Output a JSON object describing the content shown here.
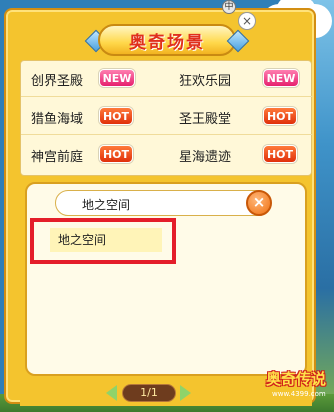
{
  "title": "奥奇场景",
  "header": {
    "pin_label": "中",
    "close_label": "×"
  },
  "scenes": [
    {
      "name": "创界圣殿",
      "badge": "NEW",
      "badge_type": "new"
    },
    {
      "name": "狂欢乐园",
      "badge": "NEW",
      "badge_type": "new"
    },
    {
      "name": "猎鱼海域",
      "badge": "HOT",
      "badge_type": "hot"
    },
    {
      "name": "圣王殿堂",
      "badge": "HOT",
      "badge_type": "hot"
    },
    {
      "name": "神宫前庭",
      "badge": "HOT",
      "badge_type": "hot"
    },
    {
      "name": "星海遗迹",
      "badge": "HOT",
      "badge_type": "hot"
    }
  ],
  "search": {
    "value": "地之空间",
    "clear_label": "×"
  },
  "results": [
    "地之空间"
  ],
  "pager": {
    "label": "1/1"
  },
  "logo": {
    "text": "奥奇传说",
    "sub": "www.4399.com"
  },
  "colors": {
    "panel": "#f4c42e",
    "new_badge": "#e6206e",
    "hot_badge": "#e0300a",
    "highlight_border": "#e41e2a"
  }
}
